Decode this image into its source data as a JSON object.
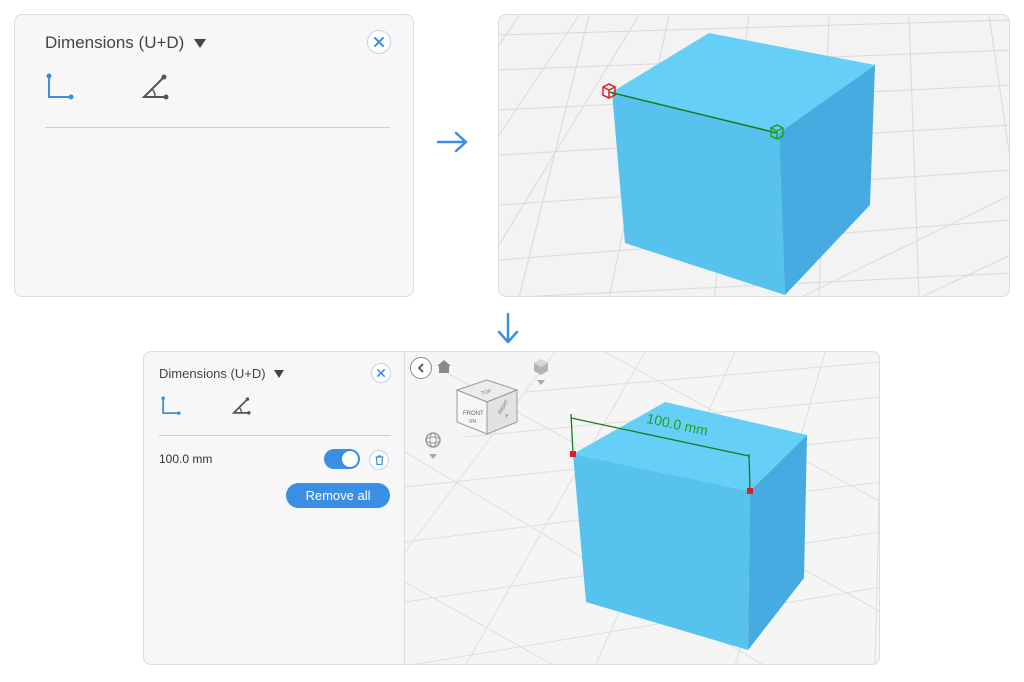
{
  "panel": {
    "title": "Dimensions (U+D)"
  },
  "icons": {
    "linear": "linear-dimension-icon",
    "angle": "angle-dimension-icon",
    "close": "close-icon",
    "caret": "caret-down-icon"
  },
  "result": {
    "measurement": "100.0 mm",
    "toggle_on": true,
    "remove_all_label": "Remove all",
    "viewport_label": "100.0 mm"
  },
  "view_cube": {
    "top": "TOP",
    "front": "FRONT",
    "front_sub": "XN",
    "right": "RIGHT",
    "right_sub": "Y"
  },
  "colors": {
    "accent": "#3a8fe3",
    "cube_top": "#62ccf5",
    "cube_front": "#55c0ec",
    "cube_side": "#47ade0",
    "dimension_line": "#1a7a1a",
    "dimension_text": "#1fa01f",
    "start_marker": "#e02020",
    "end_marker": "#21a021"
  }
}
